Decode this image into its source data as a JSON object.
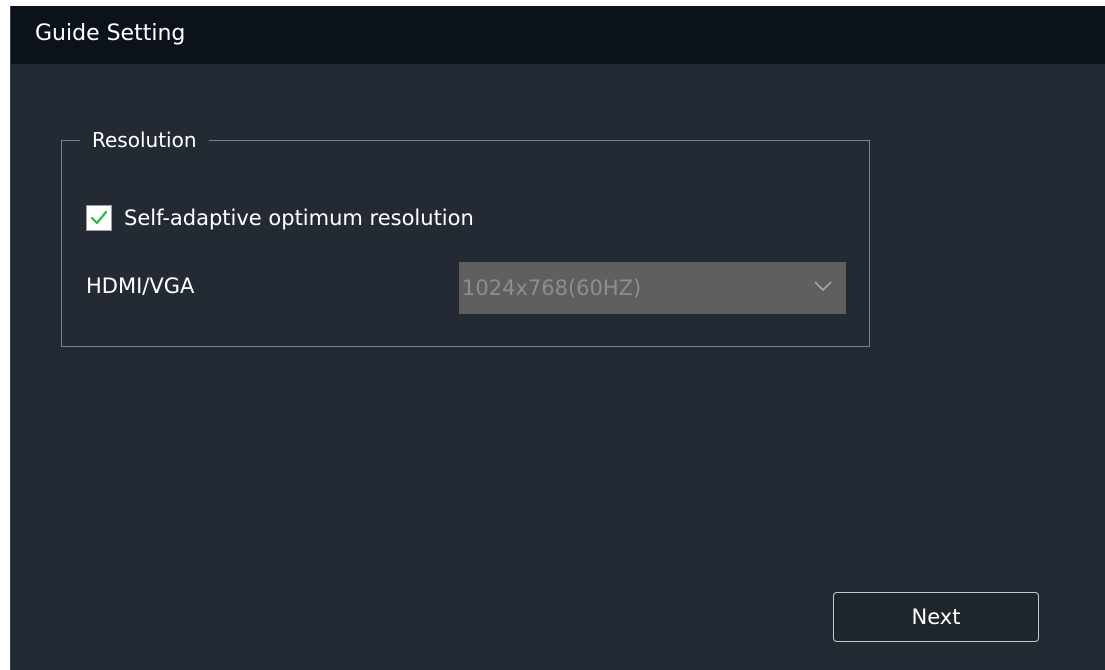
{
  "window": {
    "title": "Guide Setting"
  },
  "resolution_group": {
    "legend": "Resolution",
    "self_adaptive": {
      "label": "Self-adaptive optimum resolution",
      "checked": true
    },
    "hdmi_vga": {
      "label": "HDMI/VGA",
      "value": "1024x768(60HZ)",
      "enabled": false
    }
  },
  "footer": {
    "next_label": "Next"
  },
  "colors": {
    "titlebar": "#0c1219",
    "background": "#232a33",
    "checkmark": "#2fb24a",
    "select_disabled": "#5f5f5f"
  }
}
